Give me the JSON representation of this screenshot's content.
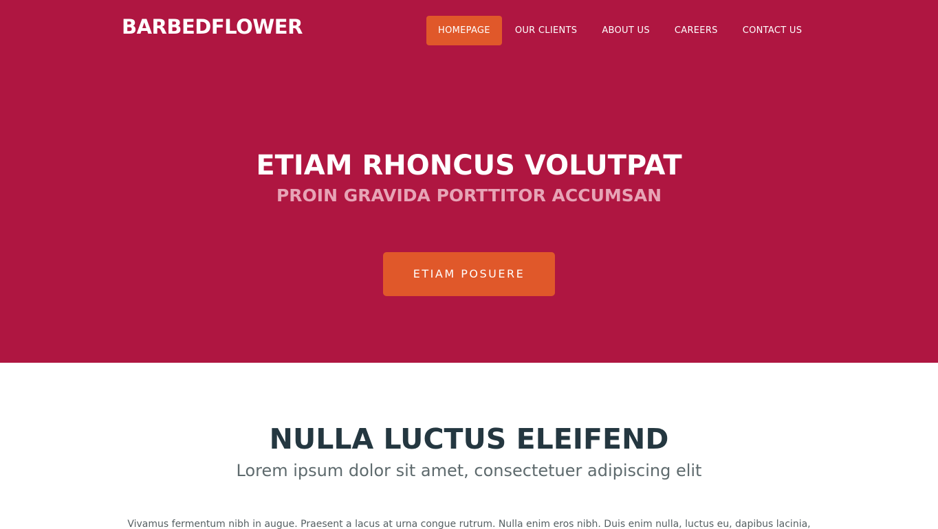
{
  "header": {
    "logo": "BARBEDFLOWER",
    "nav": [
      {
        "label": "HOMEPAGE",
        "active": true
      },
      {
        "label": "OUR CLIENTS",
        "active": false
      },
      {
        "label": "ABOUT US",
        "active": false
      },
      {
        "label": "CAREERS",
        "active": false
      },
      {
        "label": "CONTACT US",
        "active": false
      }
    ]
  },
  "hero": {
    "title": "ETIAM RHONCUS VOLUTPAT",
    "subtitle": "PROIN GRAVIDA PORTTITOR ACCUMSAN",
    "cta_label": "ETIAM POSUERE"
  },
  "section": {
    "title": "NULLA LUCTUS ELEIFEND",
    "subtitle": "Lorem ipsum dolor sit amet, consectetuer adipiscing elit",
    "body": "Vivamus fermentum nibh in augue. Praesent a lacus at urna congue rutrum. Nulla enim eros nibh. Duis enim nulla, luctus eu, dapibus lacinia,"
  },
  "colors": {
    "hero_background": "#af1641",
    "accent": "#e0582a",
    "heading_dark": "#243740"
  }
}
